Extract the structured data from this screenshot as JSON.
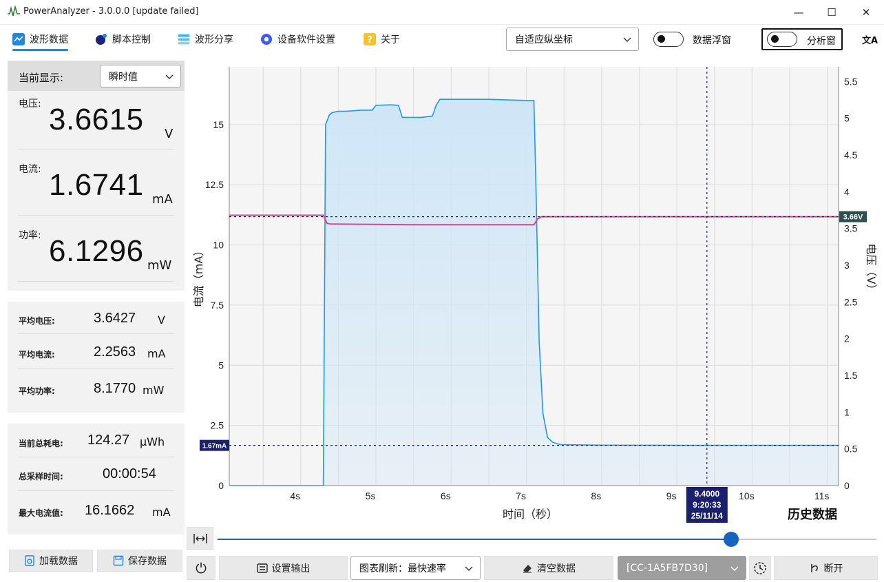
{
  "window": {
    "title": "PowerAnalyzer - 3.0.0.0  [update failed]",
    "minimize_glyph": "—",
    "maximize_glyph": "☐",
    "close_glyph": "✕"
  },
  "menu": {
    "items": [
      {
        "label": "波形数据",
        "icon": "waveform-icon"
      },
      {
        "label": "脚本控制",
        "icon": "script-icon"
      },
      {
        "label": "波形分享",
        "icon": "share-icon"
      },
      {
        "label": "设备软件设置",
        "icon": "settings-icon"
      },
      {
        "label": "关于",
        "icon": "help-icon"
      }
    ],
    "axis_mode": "自适应纵坐标",
    "float_toggle_label": "数据浮窗",
    "analysis_toggle_label": "分析窗",
    "translate_glyph": "文A"
  },
  "display": {
    "current_label": "当前显示:",
    "current_mode": "瞬时值"
  },
  "readings": {
    "voltage_label": "电压:",
    "voltage_value": "3.6615",
    "voltage_unit": "V",
    "current_label": "电流:",
    "current_value": "1.6741",
    "current_unit": "mA",
    "power_label": "功率:",
    "power_value": "6.1296",
    "power_unit": "mW"
  },
  "averages": {
    "avg_voltage_label": "平均电压:",
    "avg_voltage_value": "3.6427",
    "avg_voltage_unit": "V",
    "avg_current_label": "平均电流:",
    "avg_current_value": "2.2563",
    "avg_current_unit": "mA",
    "avg_power_label": "平均功率:",
    "avg_power_value": "8.1770",
    "avg_power_unit": "mW"
  },
  "totals": {
    "energy_label": "当前总耗电:",
    "energy_value": "124.27",
    "energy_unit": "µWh",
    "time_label": "总采样时间:",
    "time_value": "00:00:54",
    "max_current_label": "最大电流值:",
    "max_current_value": "16.1662",
    "max_current_unit": "mA"
  },
  "file_buttons": {
    "load": "加载数据",
    "save": "保存数据"
  },
  "history_label": "历史数据",
  "slider": {
    "position": 0.78
  },
  "bottom": {
    "power_glyph": "⏻",
    "output": "设置输出",
    "refresh": "图表刷新：最快速率",
    "clear": "清空数据",
    "device": "[CC-1A5FB7D30]",
    "disconnect": "断开"
  },
  "colors": {
    "current_line": "#2196f3",
    "current_fill": "#cfe6f7",
    "voltage_line": "#e4408f",
    "marker_bg": "#1a1f6e",
    "voltage_badge_bg": "#2f4f4f",
    "accent": "#1e88e5"
  },
  "chart_data": {
    "type": "line",
    "xlabel": "时间（秒）",
    "ylabel_left": "电流（mA）",
    "ylabel_right": "电压（V）",
    "xlim": [
      3.05,
      11.15
    ],
    "ylim_left": [
      0,
      17.4
    ],
    "ylim_right": [
      0,
      5.7
    ],
    "x_ticks": [
      4,
      5,
      6,
      7,
      8,
      9,
      10,
      11
    ],
    "x_tick_labels": [
      "4s",
      "5s",
      "6s",
      "7s",
      "8s",
      "9s",
      "10s",
      "11s"
    ],
    "y_left_ticks": [
      0,
      2.5,
      5,
      7.5,
      10,
      12.5,
      15
    ],
    "y_left_tick_labels": [
      "0",
      "2.5",
      "5",
      "7.5",
      "10",
      "12.5",
      "15"
    ],
    "y_right_ticks": [
      0,
      0.5,
      1,
      1.5,
      2,
      2.5,
      3,
      3.5,
      4,
      4.5,
      5,
      5.5
    ],
    "y_right_tick_labels": [
      "0",
      "0.5",
      "1",
      "1.5",
      "2",
      "2.5",
      "3",
      "3.5",
      "4",
      "4.5",
      "5",
      "5.5"
    ],
    "grid": true,
    "series": [
      {
        "name": "电流",
        "axis": "left",
        "x": [
          3.05,
          4.3,
          4.33,
          4.38,
          4.42,
          4.5,
          4.6,
          4.8,
          4.95,
          5.0,
          5.2,
          5.3,
          5.35,
          5.4,
          5.6,
          5.75,
          5.8,
          5.85,
          6.0,
          6.5,
          7.0,
          7.1,
          7.13,
          7.17,
          7.22,
          7.28,
          7.35,
          7.45,
          8.0,
          9.0,
          10.0,
          11.15
        ],
        "y": [
          0,
          0,
          15.0,
          15.4,
          15.5,
          15.55,
          15.55,
          15.6,
          15.6,
          15.8,
          15.82,
          15.8,
          15.3,
          15.3,
          15.3,
          15.35,
          15.8,
          16.05,
          16.05,
          16.05,
          16.0,
          16.0,
          12.0,
          6.0,
          3.0,
          2.0,
          1.8,
          1.7,
          1.68,
          1.67,
          1.67,
          1.67
        ]
      },
      {
        "name": "电压",
        "axis": "right",
        "x": [
          3.05,
          4.3,
          4.35,
          4.4,
          5.5,
          6.5,
          7.1,
          7.15,
          7.2,
          7.3,
          8.0,
          9.0,
          10.0,
          11.15
        ],
        "y": [
          3.68,
          3.68,
          3.57,
          3.56,
          3.55,
          3.55,
          3.55,
          3.63,
          3.66,
          3.66,
          3.66,
          3.66,
          3.66,
          3.66
        ]
      }
    ],
    "reference_lines": [
      {
        "axis": "right",
        "value": 3.66,
        "label": "3.66V"
      },
      {
        "axis": "left",
        "value": 1.67,
        "label": "1.67mA"
      }
    ],
    "cursor": {
      "x": 9.4,
      "label_lines": [
        "9.4000",
        "9:20:33",
        "25/11/14"
      ]
    }
  }
}
